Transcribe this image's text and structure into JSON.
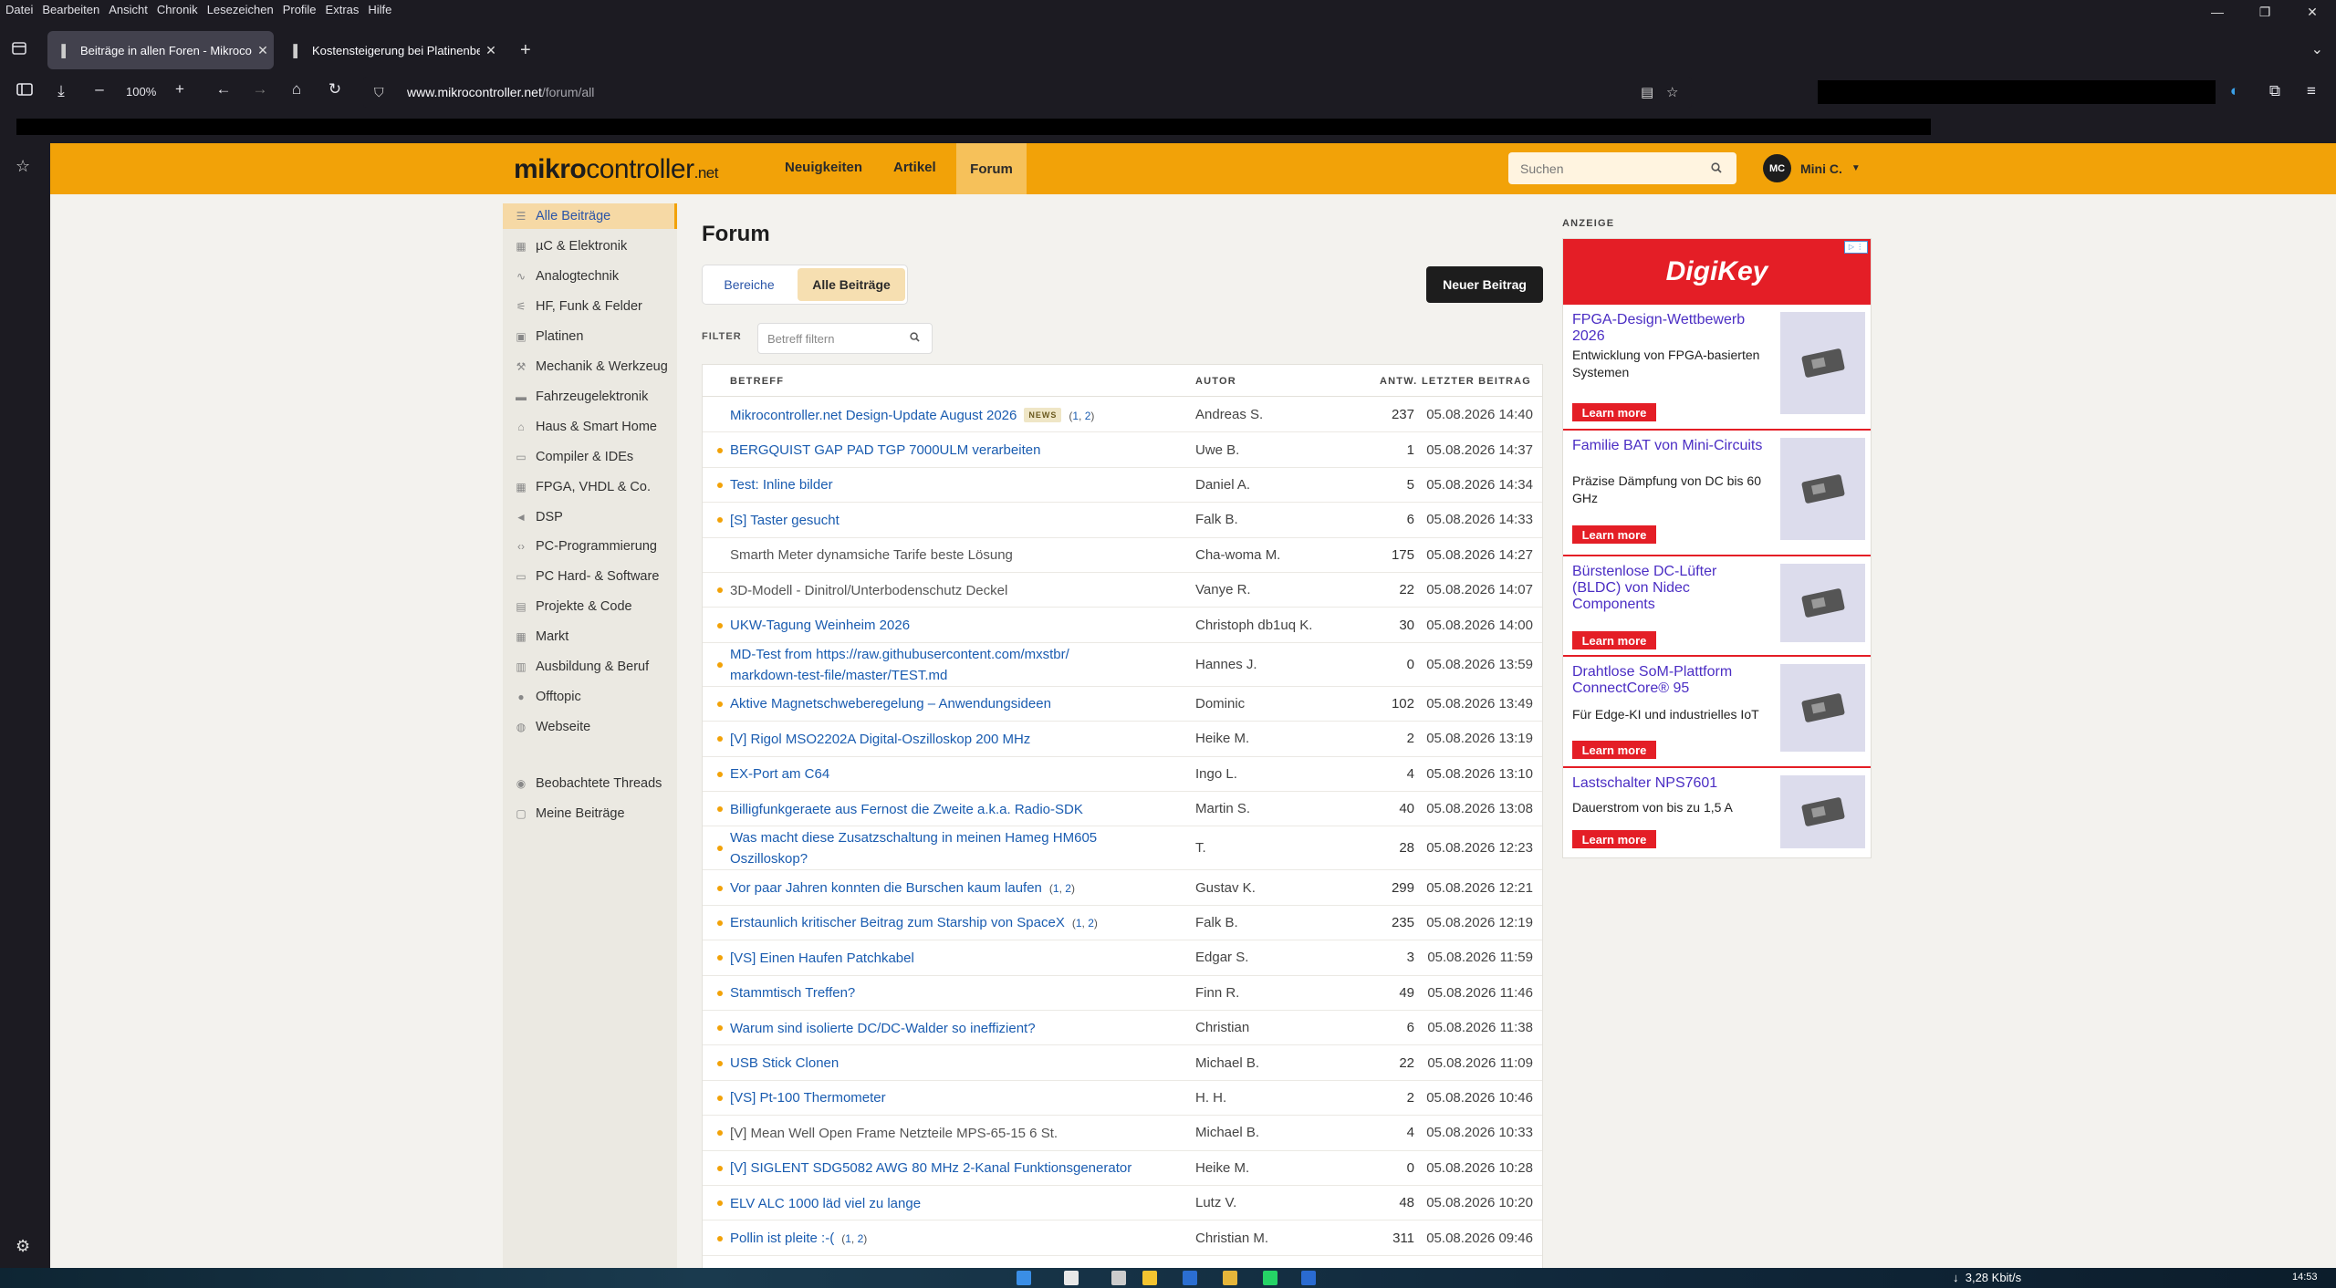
{
  "menubar": [
    "Datei",
    "Bearbeiten",
    "Ansicht",
    "Chronik",
    "Lesezeichen",
    "Profile",
    "Extras",
    "Hilfe"
  ],
  "tabs": [
    {
      "title": "Beiträge in allen Foren - Mikrocontr"
    },
    {
      "title": "Kostensteigerung bei Platinenbe"
    }
  ],
  "browser": {
    "zoom": "100%",
    "url_host": "www.mikrocontroller.net",
    "url_path": "/forum/all"
  },
  "site": {
    "logo_bold": "mikro",
    "logo_light": "controller",
    "logo_net": ".net",
    "nav": [
      "Neuigkeiten",
      "Artikel",
      "Forum"
    ],
    "search_placeholder": "Suchen",
    "user_initials": "MC",
    "user_name": "Mini C."
  },
  "forum_nav": [
    {
      "label": "Alle Beiträge",
      "icon": "list-icon"
    },
    {
      "label": "µC & Elektronik",
      "icon": "chip-icon"
    },
    {
      "label": "Analogtechnik",
      "icon": "analog-icon"
    },
    {
      "label": "HF, Funk & Felder",
      "icon": "antenna-icon"
    },
    {
      "label": "Platinen",
      "icon": "board-icon"
    },
    {
      "label": "Mechanik & Werkzeug",
      "icon": "wrench-icon"
    },
    {
      "label": "Fahrzeugelektronik",
      "icon": "car-icon"
    },
    {
      "label": "Haus & Smart Home",
      "icon": "house-icon"
    },
    {
      "label": "Compiler & IDEs",
      "icon": "terminal-icon"
    },
    {
      "label": "FPGA, VHDL & Co.",
      "icon": "fpga-icon"
    },
    {
      "label": "DSP",
      "icon": "dsp-icon"
    },
    {
      "label": "PC-Programmierung",
      "icon": "code-icon"
    },
    {
      "label": "PC Hard- & Software",
      "icon": "laptop-icon"
    },
    {
      "label": "Projekte & Code",
      "icon": "project-icon"
    },
    {
      "label": "Markt",
      "icon": "cart-icon"
    },
    {
      "label": "Ausbildung & Beruf",
      "icon": "book-icon"
    },
    {
      "label": "Offtopic",
      "icon": "chat-icon"
    },
    {
      "label": "Webseite",
      "icon": "globe-icon"
    },
    {
      "label": "Beobachtete Threads",
      "icon": "eye-icon"
    },
    {
      "label": "Meine Beiträge",
      "icon": "user-posts-icon"
    }
  ],
  "main": {
    "title": "Forum",
    "seg_left": "Bereiche",
    "seg_right": "Alle Beiträge",
    "new_post": "Neuer Beitrag",
    "filter_label": "FILTER",
    "filter_placeholder": "Betreff filtern",
    "columns": [
      "BETREFF",
      "AUTOR",
      "ANTW.",
      "LETZTER BEITRAG"
    ]
  },
  "threads": [
    {
      "subject": "Mikrocontroller.net Design-Update August 2026",
      "badge": "NEWS",
      "pages": [
        "1",
        "2"
      ],
      "author": "Andreas S.",
      "replies": "237",
      "last": "05.08.2026 14:40",
      "unread": false,
      "read": false
    },
    {
      "subject": "BERGQUIST GAP PAD TGP 7000ULM verarbeiten",
      "author": "Uwe B.",
      "replies": "1",
      "last": "05.08.2026 14:37",
      "unread": true,
      "read": false
    },
    {
      "subject": "Test: Inline bilder",
      "author": "Daniel A.",
      "replies": "5",
      "last": "05.08.2026 14:34",
      "unread": true,
      "read": false
    },
    {
      "subject": "[S] Taster gesucht",
      "author": "Falk B.",
      "replies": "6",
      "last": "05.08.2026 14:33",
      "unread": true,
      "read": false
    },
    {
      "subject": "Smarth Meter dynamsiche Tarife beste Lösung",
      "author": "Cha-woma M.",
      "replies": "175",
      "last": "05.08.2026 14:27",
      "unread": false,
      "read": true
    },
    {
      "subject": "3D-Modell - Dinitrol/Unterbodenschutz Deckel",
      "author": "Vanye R.",
      "replies": "22",
      "last": "05.08.2026 14:07",
      "unread": true,
      "read": true
    },
    {
      "subject": "UKW-Tagung Weinheim 2026",
      "author": "Christoph db1uq K.",
      "replies": "30",
      "last": "05.08.2026 14:00",
      "unread": true,
      "read": false
    },
    {
      "subject": "MD-Test from https://raw.githubusercontent.com/mxstbr/ markdown-test-file/master/TEST.md",
      "author": "Hannes J.",
      "replies": "0",
      "last": "05.08.2026 13:59",
      "unread": true,
      "read": false,
      "tall": true
    },
    {
      "subject": "Aktive Magnetschweberegelung – Anwendungsideen",
      "author": "Dominic",
      "replies": "102",
      "last": "05.08.2026 13:49",
      "unread": true,
      "read": false
    },
    {
      "subject": "[V] Rigol MSO2202A Digital-Oszilloskop 200 MHz",
      "author": "Heike M.",
      "replies": "2",
      "last": "05.08.2026 13:19",
      "unread": true,
      "read": false
    },
    {
      "subject": "EX-Port am C64",
      "author": "Ingo L.",
      "replies": "4",
      "last": "05.08.2026 13:10",
      "unread": true,
      "read": false
    },
    {
      "subject": "Billigfunkgeraete aus Fernost die Zweite a.k.a. Radio-SDK",
      "author": "Martin S.",
      "replies": "40",
      "last": "05.08.2026 13:08",
      "unread": true,
      "read": false
    },
    {
      "subject": "Was macht diese Zusatzschaltung in meinen Hameg HM605 Oszilloskop?",
      "author": "T.",
      "replies": "28",
      "last": "05.08.2026 12:23",
      "unread": true,
      "read": false,
      "tall": true
    },
    {
      "subject": "Vor paar Jahren konnten die Burschen kaum laufen",
      "pages": [
        "1",
        "2"
      ],
      "author": "Gustav K.",
      "replies": "299",
      "last": "05.08.2026 12:21",
      "unread": true,
      "read": false
    },
    {
      "subject": "Erstaunlich kritischer Beitrag zum Starship von SpaceX",
      "pages": [
        "1",
        "2"
      ],
      "author": "Falk B.",
      "replies": "235",
      "last": "05.08.2026 12:19",
      "unread": true,
      "read": false
    },
    {
      "subject": "[VS] Einen Haufen Patchkabel",
      "author": "Edgar S.",
      "replies": "3",
      "last": "05.08.2026 11:59",
      "unread": true,
      "read": false
    },
    {
      "subject": "Stammtisch Treffen?",
      "author": "Finn R.",
      "replies": "49",
      "last": "05.08.2026 11:46",
      "unread": true,
      "read": false
    },
    {
      "subject": "Warum sind isolierte DC/DC-Walder so ineffizient?",
      "author": "Christian",
      "replies": "6",
      "last": "05.08.2026 11:38",
      "unread": true,
      "read": false
    },
    {
      "subject": "USB Stick Clonen",
      "author": "Michael B.",
      "replies": "22",
      "last": "05.08.2026 11:09",
      "unread": true,
      "read": false
    },
    {
      "subject": "[VS] Pt-100 Thermometer",
      "author": "H. H.",
      "replies": "2",
      "last": "05.08.2026 10:46",
      "unread": true,
      "read": false
    },
    {
      "subject": "[V] Mean Well Open Frame Netzteile MPS-65-15 6 St.",
      "author": "Michael B.",
      "replies": "4",
      "last": "05.08.2026 10:33",
      "unread": true,
      "read": true
    },
    {
      "subject": "[V] SIGLENT SDG5082 AWG 80 MHz 2-Kanal Funktionsgenerator",
      "author": "Heike M.",
      "replies": "0",
      "last": "05.08.2026 10:28",
      "unread": true,
      "read": false
    },
    {
      "subject": "ELV ALC 1000 läd viel zu lange",
      "author": "Lutz V.",
      "replies": "48",
      "last": "05.08.2026 10:20",
      "unread": true,
      "read": false
    },
    {
      "subject": "Pollin ist pleite :-(",
      "pages": [
        "1",
        "2"
      ],
      "author": "Christian M.",
      "replies": "311",
      "last": "05.08.2026 09:46",
      "unread": true,
      "read": false
    }
  ],
  "ad": {
    "label": "ANZEIGE",
    "brand": "DigiKey",
    "cards": [
      {
        "title": "FPGA-Design-Wettbewerb 2026",
        "desc": "Entwicklung von FPGA-basierten Systemen",
        "cta": "Learn more"
      },
      {
        "title": "Familie BAT von Mini-Circuits",
        "desc": "Präzise Dämpfung von DC bis 60 GHz",
        "cta": "Learn more"
      },
      {
        "title": "Bürstenlose DC-Lüfter (BLDC) von Nidec Components",
        "desc": "",
        "cta": "Learn more"
      },
      {
        "title": "Drahtlose SoM-Plattform ConnectCore® 95",
        "desc": "Für Edge-KI und industrielles IoT",
        "cta": "Learn more"
      },
      {
        "title": "Lastschalter NPS7601",
        "desc": "Dauerstrom von bis zu 1,5 A",
        "cta": "Learn more"
      }
    ]
  },
  "taskbar": {
    "speed": "3,28 Kbit/s",
    "clock": "14:53"
  },
  "colors": {
    "accent": "#f2a208",
    "link": "#1a5cb0",
    "ad_red": "#e41e26"
  }
}
